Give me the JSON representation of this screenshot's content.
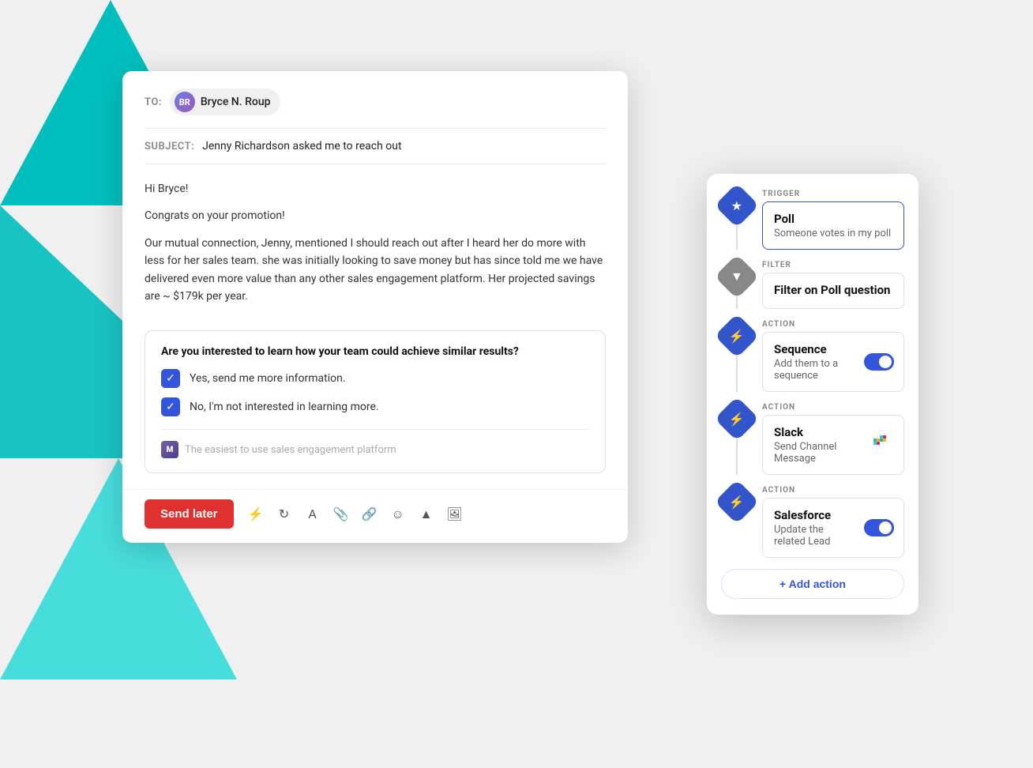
{
  "background": {
    "triangles": [
      "top",
      "bottom-left",
      "bottom-right"
    ]
  },
  "email": {
    "to_label": "TO:",
    "recipient": "Bryce N. Roup",
    "subject_label": "SUBJECT:",
    "subject": "Jenny Richardson asked me to reach out",
    "greeting": "Hi Bryce!",
    "congrats": "Congrats on your promotion!",
    "body": "Our mutual connection, Jenny, mentioned I should reach out after I heard her do more with less for her sales team. she was initially looking to save money but has since told me we have delivered even more value than any other sales engagement platform. Her projected savings are ~ $179k per year.",
    "poll_question": "Are you interested to learn how your team could achieve similar results?",
    "poll_options": [
      "Yes, send me more information.",
      "No, I'm not interested in learning more."
    ],
    "poll_footer_text": "The easiest to use sales engagement platform",
    "send_later_label": "Send later",
    "toolbar_icons": [
      "bolt",
      "refresh",
      "text",
      "attach",
      "link",
      "emoji",
      "drive",
      "image"
    ]
  },
  "automation": {
    "steps": [
      {
        "type_label": "TRIGGER",
        "icon_type": "trigger",
        "icon": "★",
        "title": "Poll",
        "subtitle": "Someone votes in my poll",
        "has_toggle": false,
        "has_slack": false
      },
      {
        "type_label": "FILTER",
        "icon_type": "filter",
        "icon": "▼",
        "title": "Filter on Poll question",
        "subtitle": "",
        "has_toggle": false,
        "has_slack": false
      },
      {
        "type_label": "ACTION",
        "icon_type": "action",
        "icon": "⚡",
        "title": "Sequence",
        "subtitle": "Add them to a sequence",
        "has_toggle": true,
        "has_slack": false
      },
      {
        "type_label": "ACTION",
        "icon_type": "action",
        "icon": "⚡",
        "title": "Slack",
        "subtitle": "Send Channel Message",
        "has_toggle": false,
        "has_slack": true
      },
      {
        "type_label": "ACTION",
        "icon_type": "action",
        "icon": "⚡",
        "title": "Salesforce",
        "subtitle": "Update the  related Lead",
        "has_toggle": true,
        "has_slack": false
      }
    ],
    "add_action_label": "+ Add action"
  }
}
